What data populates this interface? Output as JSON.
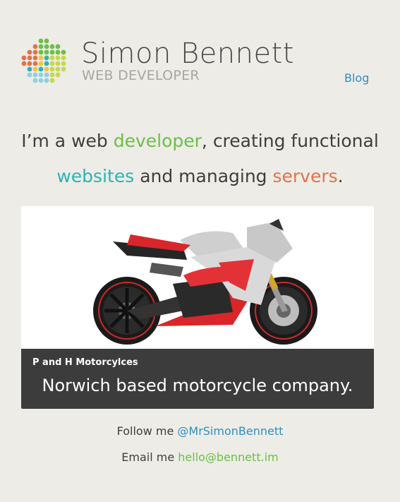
{
  "header": {
    "name": "Simon Bennett",
    "role": "WEB DEVELOPER",
    "nav": {
      "blog_label": "Blog"
    }
  },
  "tagline": {
    "part1": "I’m a web ",
    "developer": "developer",
    "part2": ", creating functional",
    "websites": "websites",
    "part3": " and managing ",
    "servers": "servers",
    "part4": "."
  },
  "project": {
    "title": "P and H Motorcylces",
    "description": "Norwich based motorcycle company."
  },
  "footer": {
    "follow_prefix": "Follow me ",
    "twitter_handle": "@MrSimonBennett",
    "email_prefix": "Email me ",
    "email_address": "hello@bennett.im"
  },
  "colors": {
    "background": "#edece6",
    "accent_green": "#6cbf47",
    "accent_teal": "#2fb3b6",
    "accent_orange": "#e0734a",
    "link_blue": "#2f8fc4"
  }
}
